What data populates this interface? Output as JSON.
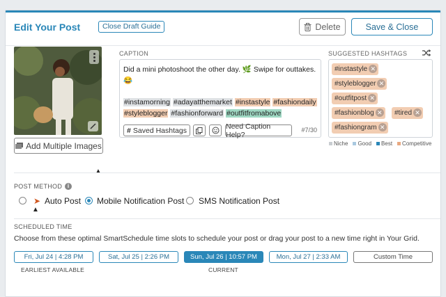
{
  "header": {
    "title": "Edit Your Post",
    "guide_label": "Close Draft Guide",
    "delete_label": "Delete",
    "save_label": "Save & Close"
  },
  "media": {
    "add_images_label": "Add Multiple Images"
  },
  "caption": {
    "label": "CAPTION",
    "text": "Did a mini photoshoot the other day. 🌿 Swipe for outtakes. 😂",
    "hashtags": [
      {
        "tag": "#instamorning",
        "level": "Niche"
      },
      {
        "tag": "#adayatthemarket",
        "level": "Niche"
      },
      {
        "tag": "#instastyle",
        "level": "Competitive"
      },
      {
        "tag": "#fashiondaily",
        "level": "Competitive"
      },
      {
        "tag": "#styleblogger",
        "level": "Competitive"
      },
      {
        "tag": "#fashionforward",
        "level": "Niche"
      },
      {
        "tag": "#outfitfromabove",
        "level": "Best"
      }
    ],
    "saved_hashtags_label": "Saved Hashtags",
    "help_label": "Need Caption Help?",
    "count": "#7/30"
  },
  "suggested": {
    "label": "SUGGESTED HASHTAGS",
    "chips": [
      "#instastyle",
      "#styleblogger",
      "#outfitpost",
      "#fashionblog",
      "#tired",
      "#fashiongram"
    ],
    "legend": [
      {
        "label": "Niche",
        "color": "#c9cdd1"
      },
      {
        "label": "Good",
        "color": "#a9c9e0"
      },
      {
        "label": "Best",
        "color": "#2a87b8"
      },
      {
        "label": "Competitive",
        "color": "#e8a981"
      }
    ]
  },
  "post_method": {
    "label": "POST METHOD",
    "options": [
      {
        "label": "Auto Post",
        "selected": false
      },
      {
        "label": "Mobile Notification Post",
        "selected": true
      },
      {
        "label": "SMS Notification Post",
        "selected": false
      }
    ]
  },
  "schedule": {
    "label": "SCHEDULED TIME",
    "description": "Choose from these optimal SmartSchedule time slots to schedule your post or drag your post to a new time right in Your Grid.",
    "slots": [
      {
        "label": "Fri, Jul 24 | 4:28 PM",
        "sub": "EARLIEST AVAILABLE"
      },
      {
        "label": "Sat, Jul 25 | 2:26 PM",
        "sub": ""
      },
      {
        "label": "Sun, Jul 26 | 10:57 PM",
        "sub": "CURRENT"
      },
      {
        "label": "Mon, Jul 27 | 2:33 AM",
        "sub": ""
      },
      {
        "label": "Custom Time",
        "sub": ""
      }
    ]
  },
  "colors": {
    "accent": "#2a87b8",
    "competitive": "#f2cdb2",
    "best": "#9fd8c3",
    "good": "#c8dceb",
    "niche": "#dfe2e5"
  }
}
